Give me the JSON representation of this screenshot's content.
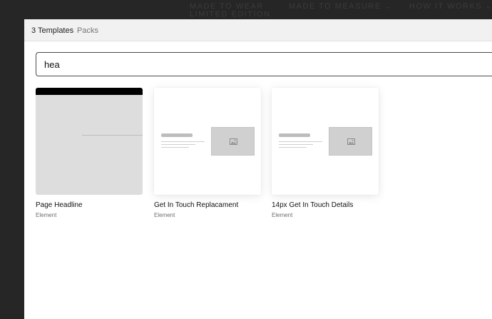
{
  "site_nav": {
    "item1_line1": "MADE TO WEAR",
    "item1_line2": "LIMITED EDITION",
    "item2": "MADE TO MEASURE",
    "item3": "HOW IT WORKS",
    "chevron": "»"
  },
  "modal": {
    "tabs": [
      {
        "label": "3 Templates",
        "active": true
      },
      {
        "label": "Packs",
        "active": false
      }
    ],
    "search": {
      "value": "hea",
      "placeholder": ""
    },
    "templates": [
      {
        "title": "Page Headline",
        "type": "Element",
        "thumbnail": "headline"
      },
      {
        "title": "Get In Touch Replacament",
        "type": "Element",
        "thumbnail": "touch-layout"
      },
      {
        "title": "14px Get In Touch Details",
        "type": "Element",
        "thumbnail": "touch-layout"
      }
    ]
  },
  "colors": {
    "backdrop": "#262626",
    "modal_bg": "#ffffff",
    "header_bg": "#f1f1f1",
    "thumb_gray": "#dddddd"
  }
}
